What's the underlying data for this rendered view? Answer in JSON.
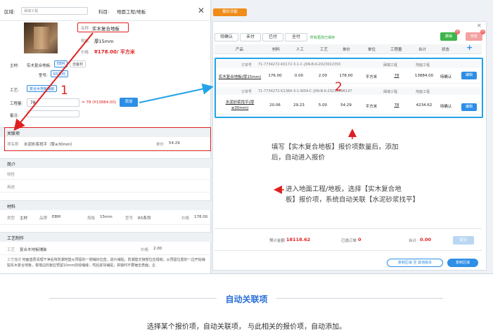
{
  "left": {
    "region_label": "区域:",
    "region_value": "闽瑞工程",
    "subject_label": "科目:",
    "subject_value": "地面工程/地板",
    "info": {
      "name_label": "名称",
      "name_value": "实木复合地板",
      "spec_label": "规格",
      "spec_value": "厚15mm",
      "price_label": "价格",
      "price_value": "¥178.00/ 平方米"
    },
    "material_label": "主材:",
    "material_name": "实木复合地板:",
    "material_tag1": "EBM",
    "material_tag2": "自备材",
    "model_label": "型号:",
    "model_tag": "R5系列",
    "craft_label": "工艺:",
    "craft_tag": "复合木地板铺装",
    "quantity_label": "工程量:",
    "quantity_value": "78",
    "quantity_calc": "= 78 (¥13884.00)",
    "add_button": "添加",
    "remark_label": "备注:",
    "related_title": "关联项",
    "related_name_label": "项名称",
    "related_name_value": "水泥砂浆找平（厚≤30mm）",
    "related_price_label": "单价",
    "related_price_value": "54.29",
    "intro_title": "简介",
    "intro_row1": "特性",
    "intro_row2": "用途",
    "materials_title": "材料",
    "mat_type_label": "类型",
    "mat_type_value": "主材",
    "mat_brand_label": "品牌",
    "mat_brand_value": "EBM",
    "mat_spec_label": "规格",
    "mat_spec_value": "15mm",
    "mat_model_label": "型号",
    "mat_model_value": "R5系列",
    "mat_price_label": "价格",
    "mat_price_value": "178.00",
    "craft_make_title": "工艺制作",
    "cm_craft_label": "工艺",
    "cm_craft_value": "复合木地板铺装",
    "cm_price_label": "价格",
    "cm_price_value": "2.00",
    "cm_desc_label": "工艺描述",
    "cm_desc_text": "地面基层清理干净后将防潮地垫从预留的一侧铺好拉直，逐片铺贴，防潮垫交接部位应错缝；从预留位置的一边开始铺贴实木复合地板，靠墙边的板应预留10mm的收缩缝，然后逐块铺贴；拼装时不要锤击表面，企"
  },
  "right": {
    "top_button": "报价功能",
    "tabs": [
      "待确认",
      "未付",
      "已付",
      "全付"
    ],
    "saved_text": "所有更改已保存",
    "btn_green": "撤销",
    "btn_pink": "恢复",
    "badge_green": "0",
    "badge_pink": "0",
    "headers": [
      "产品",
      "材料",
      "人工",
      "工艺",
      "单价",
      "单位",
      "工程量",
      "合计",
      "状态"
    ],
    "order_label": "订单号",
    "rows": [
      {
        "order_no": "71-7734272-K0172-3-1-C-JXN-B-K-20230223S5",
        "project": "闽瑞工程",
        "category": "地面工程",
        "product": "实木复合地板(厚15mm)",
        "material": "176.00",
        "labor": "0.00",
        "craft": "2.00",
        "unit_price": "178.00",
        "unit": "平方米",
        "quantity": "78",
        "total": "13884.00",
        "status": "待确认",
        "edit": "编辑"
      },
      {
        "order_no": "71-7734272-K1384-3-1-W04-C-JXN-B-K-20230196197",
        "project": "闽瑞工程",
        "category": "地面工程",
        "product": "水泥砂浆找平(厚≤30mm)",
        "material": "20.06",
        "labor": "29.23",
        "craft": "5.00",
        "unit_price": "54.29",
        "unit": "平方米",
        "quantity": "78",
        "total": "4234.62",
        "status": "待确认",
        "edit": "编辑"
      }
    ],
    "sum_est_label": "预计金额",
    "sum_est_value": "18118.62",
    "sum_paid_label": "已选订单",
    "sum_paid_value": "0",
    "sum_total_label": "合计",
    "sum_total_value": "0.00",
    "confirm_button": "提交",
    "foot_btn1": "复制区域 至 其他版本",
    "foot_btn2": "复制区域"
  },
  "annotations": {
    "num1": "1",
    "num2": "2",
    "note2_a": "填写【实木复合地板】报价项数量后，添加",
    "note2_b": "后，自动进入报价",
    "note1_a": "进入地面工程/地板，选择【实木复合地",
    "note1_b": "板】报价项，系统自动关联【水泥砂浆找平】"
  },
  "caption": {
    "title": "自动关联项",
    "subtitle": "选择某个报价项，自动关联项，  与此相关的报价项，自动添加。"
  },
  "colors": {
    "accent_blue": "#2d8ee6",
    "annotation_red": "#e02020",
    "highlight_cyan": "#22a3e8",
    "orange": "#f08c1a"
  }
}
